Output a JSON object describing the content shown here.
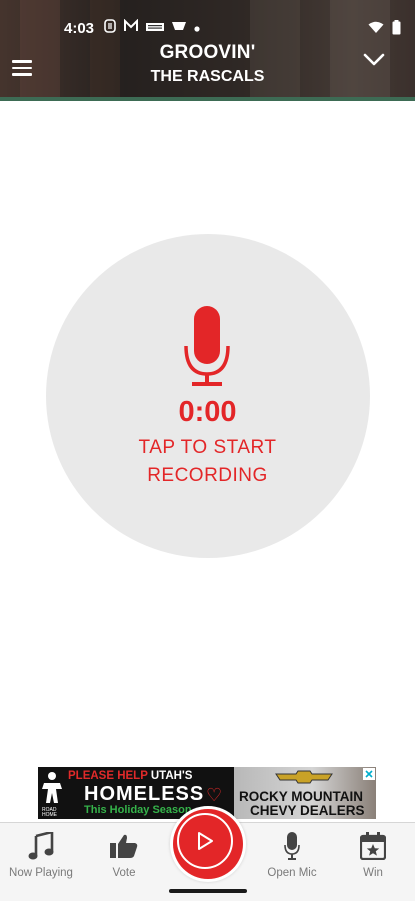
{
  "status_bar": {
    "time": "4:03",
    "left_icons": [
      "s-icon",
      "m-icon",
      "news-icon",
      "sports-icon",
      "dot-icon"
    ],
    "right_icons": [
      "wifi-icon",
      "battery-icon"
    ]
  },
  "now_playing": {
    "title": "GROOVIN'",
    "artist": "THE RASCALS"
  },
  "recorder": {
    "timer": "0:00",
    "prompt": "TAP TO START RECORDING",
    "accent_color": "#e32628",
    "circle_color": "#e9e9e9"
  },
  "ad": {
    "line1_red": "PLEASE HELP",
    "line1_white": " UTAH'S",
    "line2": "HOMELESS",
    "line3": "This Holiday Season",
    "logo_text": "THE ROAD HOME",
    "dealer_line1": "ROCKY MOUNTAIN",
    "dealer_line2": "CHEVY DEALERS",
    "close_icon": "adchoices-close-icon"
  },
  "bottom_nav": {
    "items": [
      {
        "label": "Now Playing",
        "icon": "music-note-icon"
      },
      {
        "label": "Vote",
        "icon": "thumbs-up-icon"
      },
      {
        "label": "Open Mic",
        "icon": "microphone-icon"
      },
      {
        "label": "Win",
        "icon": "calendar-star-icon"
      }
    ],
    "center_button_icon": "play-icon"
  }
}
